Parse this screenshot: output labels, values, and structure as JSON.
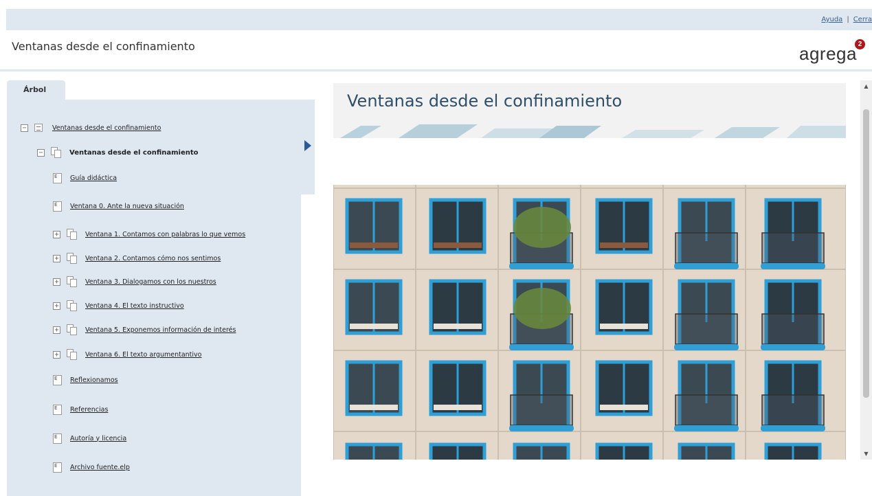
{
  "top_links": {
    "help": "Ayuda",
    "separator": "|",
    "close": "Cerra"
  },
  "header": {
    "title": "Ventanas desde el confinamiento",
    "logo_text": "agrega",
    "logo_badge": "2"
  },
  "sidebar": {
    "tab_label": "Árbol",
    "root": {
      "label": "Ventanas desde el confinamiento",
      "toggle": "−"
    },
    "section": {
      "label": "Ventanas desde el confinamiento",
      "toggle": "−"
    },
    "items": [
      {
        "label": "Guía didáctica",
        "type": "doc",
        "icon_text": "E"
      },
      {
        "label": "Ventana 0. Ante la nueva situación",
        "type": "doc",
        "icon_text": "E"
      },
      {
        "label": "Ventana 1. Contamos con palabras lo que vemos",
        "type": "folder",
        "toggle": "+"
      },
      {
        "label": "Ventana 2. Contamos cómo nos sentimos",
        "type": "folder",
        "toggle": "+"
      },
      {
        "label": "Ventana 3. Dialogamos con los nuestros",
        "type": "folder",
        "toggle": "+"
      },
      {
        "label": "Ventana 4. El texto instructivo",
        "type": "folder",
        "toggle": "+"
      },
      {
        "label": "Ventana 5. Exponemos información de interés",
        "type": "folder",
        "toggle": "+"
      },
      {
        "label": "Ventana 6. El texto argumentantivo",
        "type": "folder",
        "toggle": "+"
      },
      {
        "label": "Reflexionamos",
        "type": "doc",
        "icon_text": "E"
      },
      {
        "label": "Referencias",
        "type": "doc",
        "icon_text": "E"
      },
      {
        "label": "Autoría y licencia",
        "type": "doc",
        "icon_text": "E"
      },
      {
        "label": "Archivo fuente.elp",
        "type": "doc",
        "icon_text": "E"
      }
    ]
  },
  "main": {
    "heading": "Ventanas desde el confinamiento"
  },
  "colors": {
    "accent": "#2b5a9b",
    "panel": "#dfe7f1",
    "window_frame": "#2f9fd6",
    "badge": "#b3141a"
  }
}
